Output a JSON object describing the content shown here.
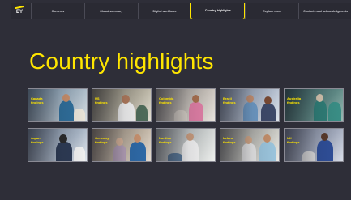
{
  "logo": {
    "text": "EY"
  },
  "nav": {
    "items": [
      {
        "label": "Contents"
      },
      {
        "label": "Global summary"
      },
      {
        "label": "Digital workforce"
      },
      {
        "label": "Country highlights",
        "active": true
      },
      {
        "label": "Explore more"
      },
      {
        "label": "Contacts and acknowledgments"
      }
    ]
  },
  "page": {
    "title": "Country highlights"
  },
  "tiles": [
    {
      "country": "Canada",
      "suffix": "findings"
    },
    {
      "country": "US",
      "suffix": "findings"
    },
    {
      "country": "Colombia",
      "suffix": "findings"
    },
    {
      "country": "Brazil",
      "suffix": "findings"
    },
    {
      "country": "Australia",
      "suffix": "findings"
    },
    {
      "country": "Japan",
      "suffix": "findings"
    },
    {
      "country": "Germany",
      "suffix": "findings"
    },
    {
      "country": "Nordics",
      "suffix": "findings"
    },
    {
      "country": "Ireland",
      "suffix": "findings"
    },
    {
      "country": "UK",
      "suffix": "findings"
    }
  ],
  "colors": {
    "accent": "#ffe600",
    "background": "#2e2e38"
  }
}
